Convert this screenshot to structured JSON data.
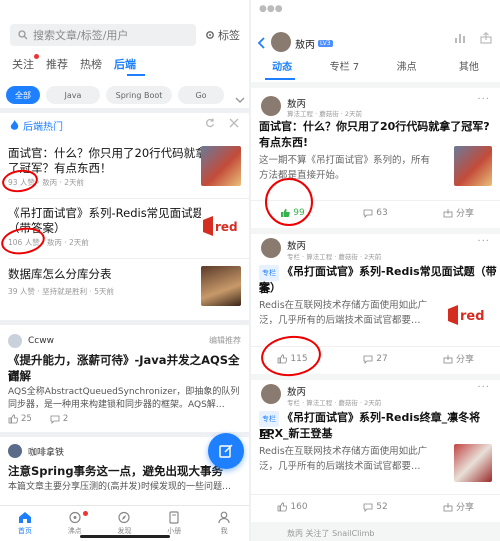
{
  "left": {
    "search": {
      "placeholder": "搜索文章/标签/用户"
    },
    "tag_button": "标签",
    "tabs": [
      {
        "label": "关注",
        "dot": true
      },
      {
        "label": "推荐"
      },
      {
        "label": "热榜"
      },
      {
        "label": "后端",
        "active": true
      }
    ],
    "chips": [
      "全部",
      "Java",
      "Spring Boot",
      "Go"
    ],
    "hot_header": "后端热门",
    "hot_articles": [
      {
        "title_line1": "面试官：什么？你只用了20行代码就拿",
        "title_line2": "了冠军？有点东西！",
        "likes": "93 人赞",
        "meta": "敖丙 · 2天前"
      },
      {
        "title_line1": "《吊打面试官》系列-Redis常见面试题",
        "title_line2": "（带答案）",
        "likes": "106 人赞",
        "meta": "敖丙 · 2天前"
      },
      {
        "title_line1": "数据库怎么分库分表",
        "title_line2": "",
        "likes": "39 人赞",
        "meta": "坚持就是胜利 · 5天前"
      }
    ],
    "feed_author": "Ccww",
    "feed_tag": "编辑推荐",
    "feed_title_line1": "《提升能力，涨薪可待》-Java并发之AQS全面",
    "feed_title_line2": "详解",
    "feed_desc_line1": "AQS全称AbstractQueuedSynchronizer，即抽象的队列",
    "feed_desc_line2": "同步器，是一种用来构建锁和同步器的框架。AQS解…",
    "feed_likes": "25",
    "feed_comments": "2",
    "feed2_author": "咖啡拿铁",
    "feed2_title": "注意Spring事务这一点，避免出现大事务",
    "feed2_desc": "本篇文章主要分享压测的(高并发)时候发现的一些问题…",
    "nav": [
      "首页",
      "沸点",
      "发现",
      "小册",
      "我"
    ]
  },
  "right": {
    "user_name": "敖丙",
    "user_badge": "LV3",
    "tabs": [
      "动态",
      "专栏 7",
      "沸点",
      "其他"
    ],
    "cards": [
      {
        "name": "敖丙",
        "sub": "算法工程 · 蘑菇街 · 2天前",
        "title_line1": "面试官：什么？你只用了20行代码就拿了冠军?",
        "title_line2": "有点东西!",
        "desc_line1": "这一期不算《吊打面试官》系列的，所有",
        "desc_line2": "方法都是直接开始。",
        "likes": "99",
        "comments": "63",
        "share": "分享"
      },
      {
        "name": "敖丙",
        "sub": "专栏 · 算法工程 · 蘑菇街 · 2天前",
        "tag": "专栏",
        "title_line1": "《吊打面试官》系列-Redis常见面试题（带答",
        "title_line2": "案）",
        "desc_line1": "Redis在互联网技术存储方面使用如此广",
        "desc_line2": "泛，几乎所有的后端技术面试官都要…",
        "likes": "115",
        "comments": "27",
        "share": "分享"
      },
      {
        "name": "敖丙",
        "sub": "专栏 · 算法工程 · 蘑菇街 · 2天前",
        "tag": "专栏",
        "title_line1": "《吊打面试官》系列-Redis终章_凛冬将至、",
        "title_line2": "FPX_新王登基",
        "desc_line1": "Redis在互联网技术存储方面使用如此广",
        "desc_line2": "泛，几乎所有的后端技术面试官都要…",
        "likes": "160",
        "comments": "52",
        "share": "分享"
      }
    ],
    "footer_peek": "敖丙 关注了 SnailClimb"
  },
  "colors": {
    "accent": "#1e80ff",
    "liked": "#37b24d",
    "annotation": "#e00000"
  }
}
